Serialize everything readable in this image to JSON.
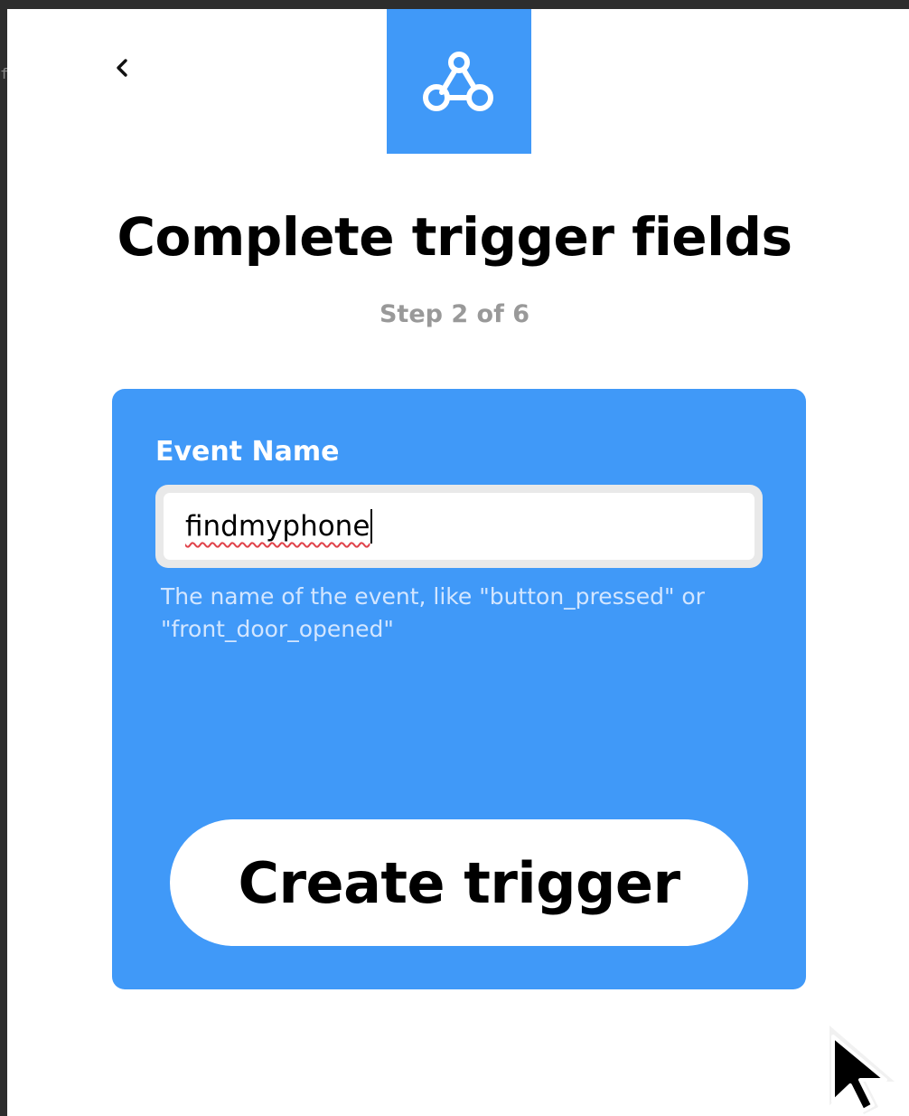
{
  "window": {
    "edge_glyph": "f"
  },
  "header": {
    "back_icon": "chevron-left-icon",
    "service_icon": "webhooks-icon",
    "service_color": "#4099f8"
  },
  "page": {
    "title": "Complete trigger fields",
    "step": "Step 2 of 6"
  },
  "form": {
    "field_label": "Event Name",
    "field_value": "findmyphone",
    "helper_text": "The name of the event, like \"button_pressed\" or \"front_door_opened\"",
    "submit_label": "Create trigger",
    "card_color": "#4099f8"
  }
}
